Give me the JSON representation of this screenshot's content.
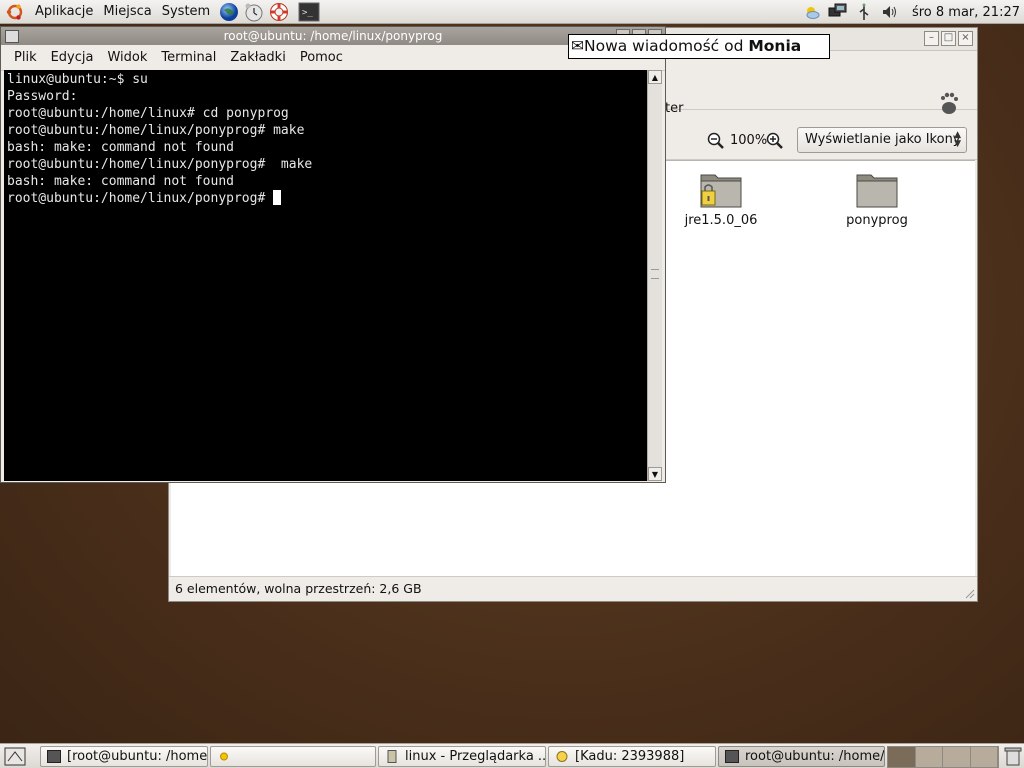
{
  "top_panel": {
    "menus": [
      "Aplikacje",
      "Miejsca",
      "System"
    ],
    "launchers": [
      "globe-icon",
      "clock-icon",
      "lifebuoy-icon",
      "terminal-icon"
    ],
    "tray_icons": [
      "weather-icon",
      "network-icon",
      "usb-icon",
      "volume-icon"
    ],
    "clock": "śro  8 mar, 21:27"
  },
  "terminal": {
    "title": "root@ubuntu: /home/linux/ponyprog",
    "menus": [
      "Plik",
      "Edycja",
      "Widok",
      "Terminal",
      "Zakładki",
      "Pomoc"
    ],
    "lines": [
      "linux@ubuntu:~$ su",
      "Password:",
      "root@ubuntu:/home/linux# cd ponyprog",
      "root@ubuntu:/home/linux/ponyprog# make",
      "bash: make: command not found",
      "root@ubuntu:/home/linux/ponyprog#  make",
      "bash: make: command not found",
      "root@ubuntu:/home/linux/ponyprog# "
    ]
  },
  "notification": {
    "prefix": "Nowa wiadomość od ",
    "sender": "Monia"
  },
  "file_manager": {
    "partial_label": "ter",
    "zoom": "100%",
    "view_mode": "Wyświetlanie jako Ikony",
    "folders": [
      {
        "name": "jre1.5.0_06",
        "locked": true
      },
      {
        "name": "ponyprog",
        "locked": false
      }
    ],
    "status": "6 elementów, wolna przestrzeń: 2,6 GB"
  },
  "taskbar": {
    "tasks": [
      {
        "label": "[root@ubuntu: /home..."
      },
      {
        "label": ""
      },
      {
        "label": "linux - Przeglądarka ..."
      },
      {
        "label": "[Kadu: 2393988]"
      },
      {
        "label": "root@ubuntu: /home/..."
      }
    ]
  }
}
